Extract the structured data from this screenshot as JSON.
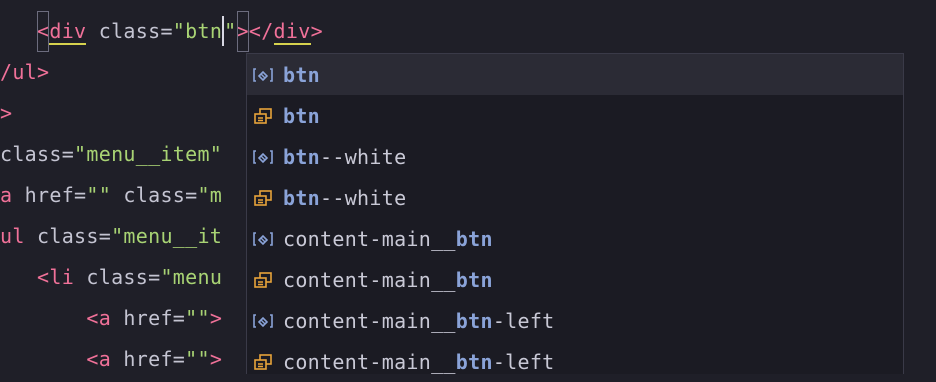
{
  "editor": {
    "lines": [
      {
        "indent": "   ",
        "tag_open": "<",
        "tag_name": "div",
        "attr": " class=",
        "value": "\"btn",
        "value_end": "\"",
        "close_open": "</",
        "close_name": "div",
        "close_end": ">"
      },
      {
        "a": "/ul",
        "b": ">"
      },
      {
        "a": ">"
      },
      {
        "attr": "class=",
        "value": "\"menu__item\""
      },
      {
        "a_tag": "a",
        "attr": " href=",
        "value": "\"\"",
        "attr2": " class=",
        "value2": "\"m"
      },
      {
        "a_tag": "ul",
        "attr": " class=",
        "value": "\"menu__it"
      },
      {
        "indent": "   ",
        "lt": "<",
        "tag": "li",
        "attr": " class=",
        "value": "\"menu"
      },
      {
        "indent": "       ",
        "lt": "<",
        "tag": "a",
        "attr": " href=",
        "value": "\"\"",
        "gt": ">"
      },
      {
        "indent": "       ",
        "lt": "<",
        "tag": "a",
        "attr": " href=",
        "value": "\"\"",
        "gt": ">"
      }
    ]
  },
  "autocomplete": {
    "items": [
      {
        "icon": "class-icon",
        "bold": "btn",
        "prefix": "",
        "suffix": ""
      },
      {
        "icon": "snippet-icon",
        "bold": "btn",
        "prefix": "",
        "suffix": ""
      },
      {
        "icon": "class-icon",
        "bold": "btn",
        "prefix": "",
        "suffix": "--white"
      },
      {
        "icon": "snippet-icon",
        "bold": "btn",
        "prefix": "",
        "suffix": "--white"
      },
      {
        "icon": "class-icon",
        "bold": "btn",
        "prefix": "content-main__",
        "suffix": ""
      },
      {
        "icon": "snippet-icon",
        "bold": "btn",
        "prefix": "content-main__",
        "suffix": ""
      },
      {
        "icon": "class-icon",
        "bold": "btn",
        "prefix": "content-main__",
        "suffix": "-left"
      },
      {
        "icon": "snippet-icon",
        "bold": "btn",
        "prefix": "content-main__",
        "suffix": "-left"
      }
    ],
    "selected_index": 0
  },
  "colors": {
    "background": "#1f1f28",
    "tag": "#f07199",
    "string": "#a8d374",
    "match": "#8aa3d8",
    "class_icon": "#8aa3d8",
    "snippet_icon": "#e8a33a"
  }
}
